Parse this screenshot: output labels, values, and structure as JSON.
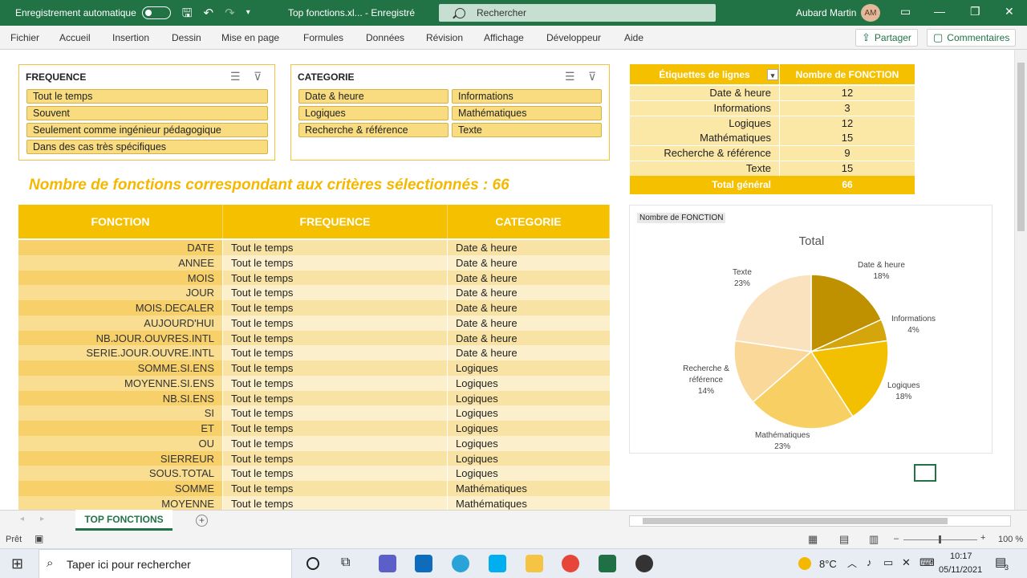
{
  "titlebar": {
    "autosave_label": "Enregistrement automatique",
    "filename": "Top fonctions.xl...  -  Enregistré",
    "search_placeholder": "Rechercher",
    "user_name": "Aubard Martin",
    "user_initials": "AM"
  },
  "ribbon": {
    "tabs": [
      "Fichier",
      "Accueil",
      "Insertion",
      "Dessin",
      "Mise en page",
      "Formules",
      "Données",
      "Révision",
      "Affichage",
      "Développeur",
      "Aide"
    ],
    "share_label": "Partager",
    "comments_label": "Commentaires"
  },
  "slicer_frequence": {
    "title": "FREQUENCE",
    "items": [
      "Tout le temps",
      "Souvent",
      "Seulement comme ingénieur pédagogique",
      "Dans des cas très spécifiques"
    ]
  },
  "slicer_categorie": {
    "title": "CATEGORIE",
    "items": [
      "Date & heure",
      "Informations",
      "Logiques",
      "Mathématiques",
      "Recherche & référence",
      "Texte"
    ]
  },
  "headline": "Nombre de fonctions correspondant aux critères sélectionnés : 66",
  "table": {
    "headers": [
      "FONCTION",
      "FREQUENCE",
      "CATEGORIE"
    ],
    "rows": [
      [
        "DATE",
        "Tout le temps",
        "Date & heure"
      ],
      [
        "ANNEE",
        "Tout le temps",
        "Date & heure"
      ],
      [
        "MOIS",
        "Tout le temps",
        "Date & heure"
      ],
      [
        "JOUR",
        "Tout le temps",
        "Date & heure"
      ],
      [
        "MOIS.DECALER",
        "Tout le temps",
        "Date & heure"
      ],
      [
        "AUJOURD'HUI",
        "Tout le temps",
        "Date & heure"
      ],
      [
        "NB.JOUR.OUVRES.INTL",
        "Tout le temps",
        "Date & heure"
      ],
      [
        "SERIE.JOUR.OUVRE.INTL",
        "Tout le temps",
        "Date & heure"
      ],
      [
        "SOMME.SI.ENS",
        "Tout le temps",
        "Logiques"
      ],
      [
        "MOYENNE.SI.ENS",
        "Tout le temps",
        "Logiques"
      ],
      [
        "NB.SI.ENS",
        "Tout le temps",
        "Logiques"
      ],
      [
        "SI",
        "Tout le temps",
        "Logiques"
      ],
      [
        "ET",
        "Tout le temps",
        "Logiques"
      ],
      [
        "OU",
        "Tout le temps",
        "Logiques"
      ],
      [
        "SIERREUR",
        "Tout le temps",
        "Logiques"
      ],
      [
        "SOUS.TOTAL",
        "Tout le temps",
        "Logiques"
      ],
      [
        "SOMME",
        "Tout le temps",
        "Mathématiques"
      ],
      [
        "MOYENNE",
        "Tout le temps",
        "Mathématiques"
      ]
    ]
  },
  "pivot": {
    "headers": [
      "Étiquettes de lignes",
      "Nombre de FONCTION"
    ],
    "rows": [
      [
        "Date & heure",
        "12"
      ],
      [
        "Informations",
        "3"
      ],
      [
        "Logiques",
        "12"
      ],
      [
        "Mathématiques",
        "15"
      ],
      [
        "Recherche & référence",
        "9"
      ],
      [
        "Texte",
        "15"
      ]
    ],
    "total_label": "Total général",
    "total_value": "66"
  },
  "chart_data": {
    "type": "pie",
    "tag": "Nombre de FONCTION",
    "title": "Total",
    "categories": [
      "Date & heure",
      "Informations",
      "Logiques",
      "Mathématiques",
      "Recherche & référence",
      "Texte"
    ],
    "values": [
      12,
      3,
      12,
      15,
      9,
      15
    ],
    "percent_labels": [
      "18%",
      "4%",
      "18%",
      "23%",
      "14%",
      "23%"
    ],
    "colors": [
      "#bf9000",
      "#d4a60c",
      "#f2c000",
      "#f7cf62",
      "#fad89a",
      "#fbe2bf"
    ]
  },
  "sheet_tab": "TOP FONCTIONS",
  "status": {
    "ready": "Prêt",
    "zoom": "100 %"
  },
  "taskbar": {
    "search_placeholder": "Taper ici pour rechercher",
    "temperature": "8°C",
    "time": "10:17",
    "date": "05/11/2021",
    "notifications": "3"
  }
}
